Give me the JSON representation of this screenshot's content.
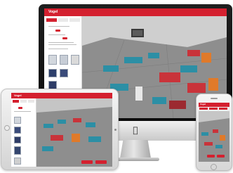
{
  "app": {
    "logo_text": "Vogel",
    "tabs": [
      "",
      "",
      ""
    ],
    "actions": [
      "",
      ""
    ]
  },
  "colors": {
    "brand_red": "#d4202f",
    "floor_gray": "#8e8e8e",
    "wall_gray": "#c8c8c8",
    "chair_teal": "#2c8fa5",
    "sofa_red": "#c9333a",
    "accent_orange": "#e07a2a"
  },
  "icons": {
    "os_logo": "apple-logo-icon",
    "home_button": "home-button-icon",
    "camera": "camera-icon",
    "speaker": "speaker-icon"
  }
}
